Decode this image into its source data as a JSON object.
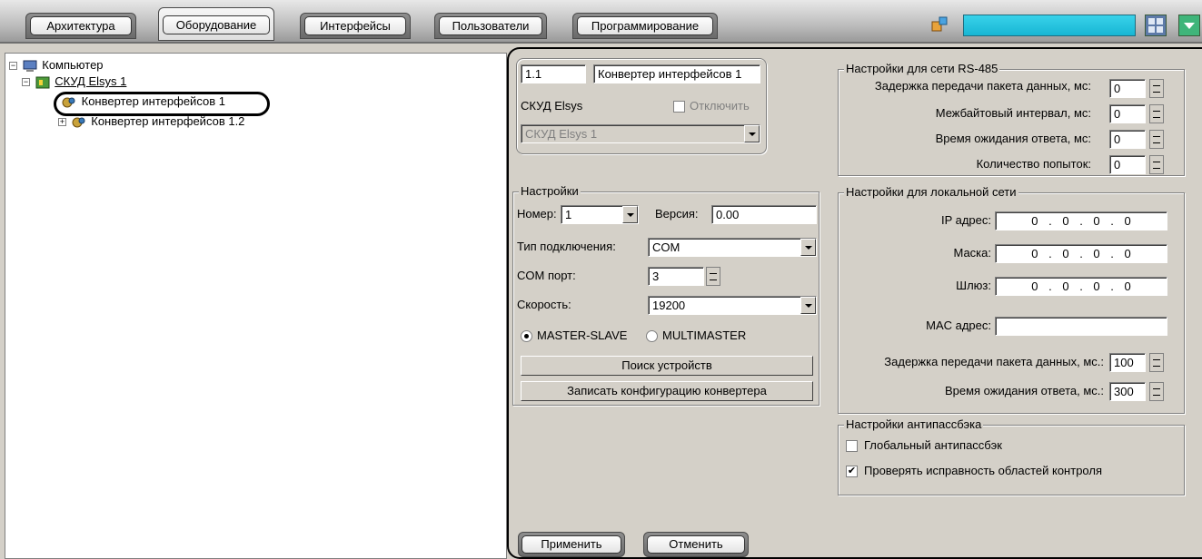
{
  "tabs": [
    {
      "label": "Архитектура"
    },
    {
      "label": "Оборудование",
      "active": true
    },
    {
      "label": "Интерфейсы"
    },
    {
      "label": "Пользователи"
    },
    {
      "label": "Программирование"
    }
  ],
  "tree": {
    "root": "Компьютер",
    "acs": "СКУД Elsys 1",
    "converter1": "Конвертер интерфейсов 1",
    "converter2": "Конвертер интерфейсов 1.2"
  },
  "device": {
    "id": "1.1",
    "name": "Конвертер интерфейсов 1",
    "parent_label": "СКУД Elsys",
    "disable_label": "Отключить",
    "parent_select": "СКУД Elsys 1"
  },
  "settings": {
    "legend": "Настройки",
    "number_label": "Номер:",
    "number_value": "1",
    "version_label": "Версия:",
    "version_value": "0.00",
    "conn_type_label": "Тип подключения:",
    "conn_type_value": "COM",
    "com_port_label": "COM порт:",
    "com_port_value": "3",
    "speed_label": "Скорость:",
    "speed_value": "19200",
    "mode_master_slave": "MASTER-SLAVE",
    "mode_multimaster": "MULTIMASTER",
    "search_button": "Поиск устройств",
    "write_config_button": "Записать конфигурацию конвертера"
  },
  "rs485": {
    "legend": "Настройки для сети RS-485",
    "delay_label": "Задержка передачи пакета данных, мс:",
    "delay_value": "0",
    "interbyte_label": "Межбайтовый интервал, мс:",
    "interbyte_value": "0",
    "timeout_label": "Время ожидания ответа, мс:",
    "timeout_value": "0",
    "attempts_label": "Количество попыток:",
    "attempts_value": "0"
  },
  "lan": {
    "legend": "Настройки для локальной сети",
    "ip_label": "IP адрес:",
    "ip_value": "0 . 0 . 0 . 0",
    "mask_label": "Маска:",
    "mask_value": "0 . 0 . 0 . 0",
    "gateway_label": "Шлюз:",
    "gateway_value": "0 . 0 . 0 . 0",
    "mac_label": "MAC адрес:",
    "mac_value": "",
    "delay_label": "Задержка передачи пакета данных, мс.:",
    "delay_value": "100",
    "timeout_label": "Время ожидания ответа, мс.:",
    "timeout_value": "300"
  },
  "antipassback": {
    "legend": "Настройки антипассбэка",
    "global_label": "Глобальный антипассбэк",
    "global_checked": false,
    "check_areas_label": "Проверять исправность областей контроля",
    "check_areas_checked": true
  },
  "footer": {
    "apply": "Применить",
    "cancel": "Отменить"
  },
  "colors": {
    "panel": "#d4d0c8",
    "search_accent": "#17b6d4"
  }
}
